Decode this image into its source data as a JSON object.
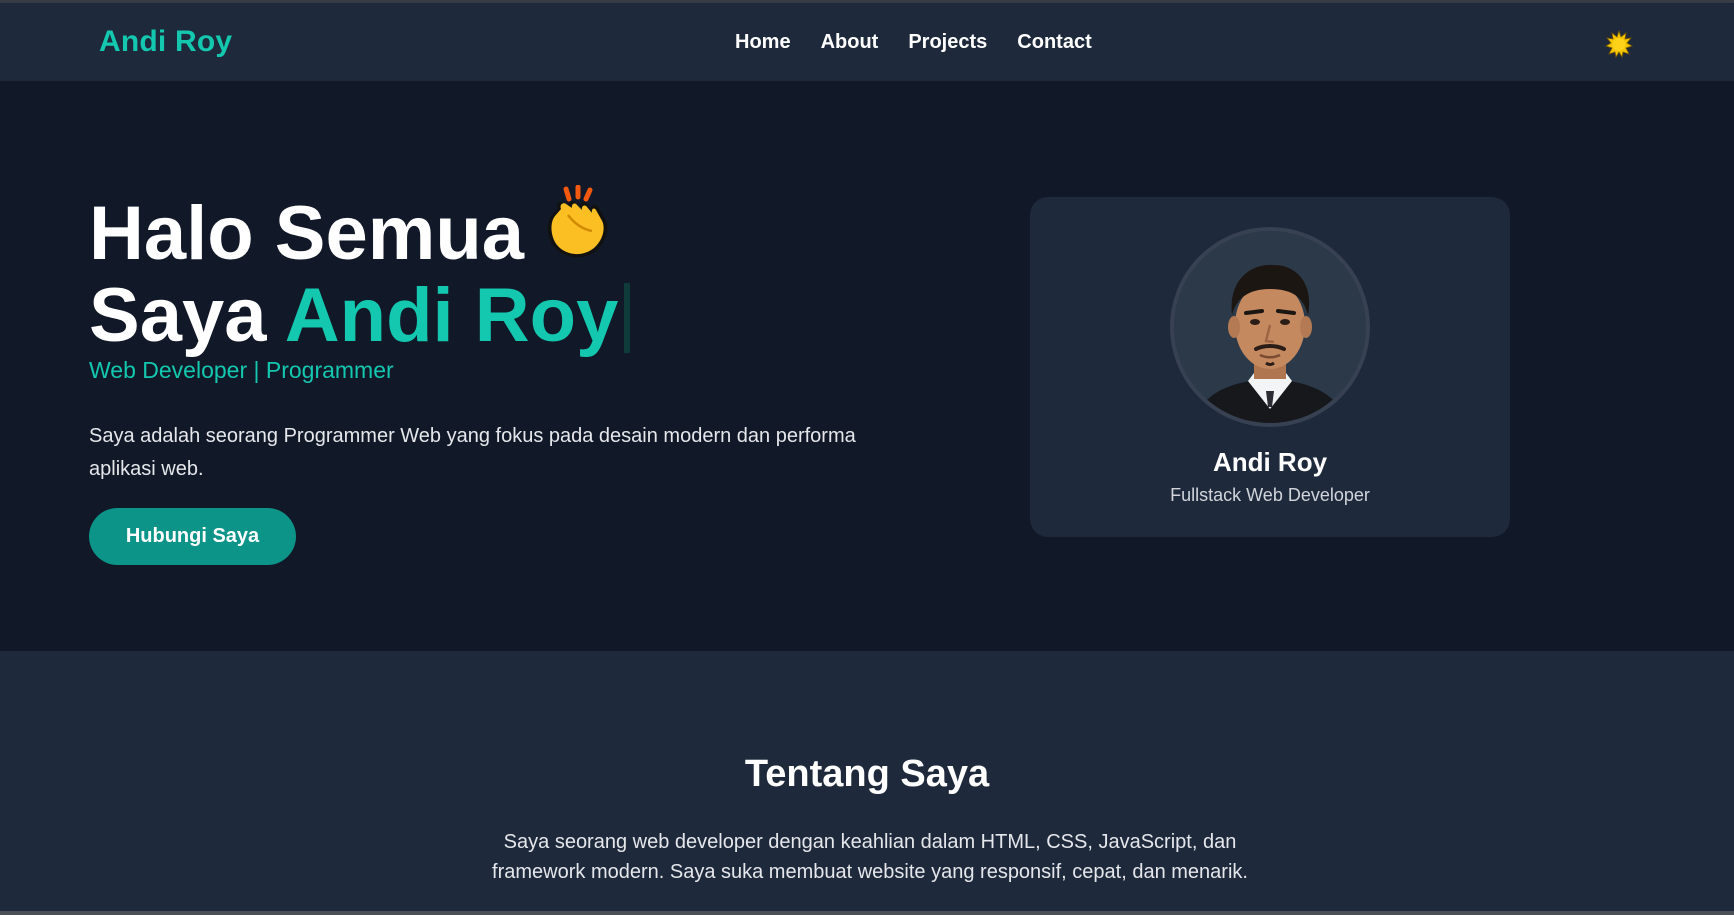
{
  "brand": {
    "name": "Andi Roy"
  },
  "nav": {
    "items": [
      "Home",
      "About",
      "Projects",
      "Contact"
    ]
  },
  "theme_toggle": {
    "icon": "sun-icon"
  },
  "hero": {
    "line1": "Halo Semua",
    "line2_prefix": "Saya",
    "line2_name": "Andi Roy",
    "wave_icon": "clapping-hands-icon",
    "subtitle": "Web Developer | Programmer",
    "description": "Saya adalah seorang Programmer Web yang fokus pada desain modern dan performa aplikasi web.",
    "cta_label": "Hubungi Saya"
  },
  "profile_card": {
    "name": "Andi Roy",
    "role": "Fullstack Web Developer"
  },
  "about": {
    "title": "Tentang Saya",
    "text": "Saya seorang web developer dengan keahlian dalam HTML, CSS, JavaScript, dan framework modern. Saya suka membuat website yang responsif, cepat, dan menarik."
  },
  "colors": {
    "accent": "#14c8b0",
    "button": "#0d9488",
    "background": "#111827",
    "surface": "#1e293b"
  }
}
